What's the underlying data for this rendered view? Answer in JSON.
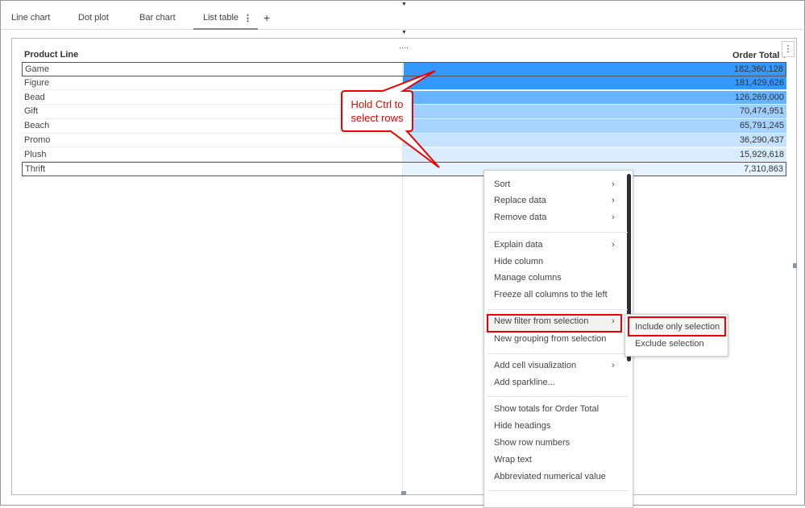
{
  "tabs": [
    {
      "label": "Line chart"
    },
    {
      "label": "Dot plot"
    },
    {
      "label": "Bar chart"
    },
    {
      "label": "List table",
      "active": true
    }
  ],
  "tab_more_icon": "⋮",
  "add_tab_icon": "+",
  "table": {
    "columns": [
      "Product Line",
      "Order Total"
    ],
    "sort_indicator": "▾",
    "rows": [
      {
        "name": "Game",
        "value": "182,360,128",
        "color": "#3399ff",
        "selected": true
      },
      {
        "name": "Figure",
        "value": "181,429,626",
        "color": "#3399ff"
      },
      {
        "name": "Bead",
        "value": "126,269,000",
        "color": "#66b3ff"
      },
      {
        "name": "Gift",
        "value": "70,474,951",
        "color": "#a0d0ff"
      },
      {
        "name": "Beach",
        "value": "65,791,245",
        "color": "#a6d3ff"
      },
      {
        "name": "Promo",
        "value": "36,290,437",
        "color": "#c5e3ff"
      },
      {
        "name": "Plush",
        "value": "15,929,618",
        "color": "#d9edff"
      },
      {
        "name": "Thrift",
        "value": "7,310,863",
        "color": "#e6f3ff",
        "selected": true
      }
    ]
  },
  "callout": {
    "line1": "Hold Ctrl to",
    "line2": "select rows",
    "color": "#ee0000"
  },
  "menu": {
    "items": [
      {
        "label": "Sort",
        "sub": true
      },
      {
        "label": "Replace data",
        "sub": true
      },
      {
        "label": "Remove data",
        "sub": true
      },
      {
        "label": "Explain data",
        "sub": true
      },
      {
        "label": "Hide column"
      },
      {
        "label": "Manage columns"
      },
      {
        "label": "Freeze all columns to the left"
      },
      {
        "label": "New filter from selection",
        "sub": true,
        "highlighted": true
      },
      {
        "label": "New grouping from selection"
      },
      {
        "label": "Add cell visualization",
        "sub": true
      },
      {
        "label": "Add sparkline..."
      },
      {
        "label": "Show totals for Order Total"
      },
      {
        "label": "Hide headings"
      },
      {
        "label": "Show row numbers"
      },
      {
        "label": "Wrap text"
      },
      {
        "label": "Abbreviated numerical value"
      }
    ],
    "submenu": [
      {
        "label": "Include only selection",
        "highlighted": true
      },
      {
        "label": "Exclude selection"
      }
    ]
  }
}
